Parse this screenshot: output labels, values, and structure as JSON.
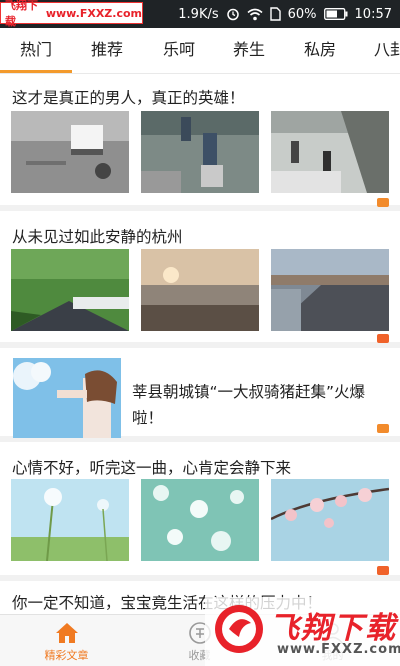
{
  "status_bar": {
    "watermark_brand": "飞翔下载",
    "watermark_url": "www.FXXZ.com",
    "speed": "1.9K/s",
    "battery": "60%",
    "time": "10:57"
  },
  "tabs": [
    {
      "label": "热门",
      "active": true
    },
    {
      "label": "推荐",
      "active": false
    },
    {
      "label": "乐呵",
      "active": false
    },
    {
      "label": "养生",
      "active": false
    },
    {
      "label": "私房",
      "active": false
    },
    {
      "label": "八卦",
      "active": false
    }
  ],
  "articles": [
    {
      "title": "这才是真正的男人，真正的英雄！",
      "layout": "three-images",
      "tag": "photo-icon"
    },
    {
      "title": "从未见过如此安静的杭州",
      "layout": "three-images",
      "tag": "video-icon"
    },
    {
      "title": "莘县朝城镇“一大叔骑猪赶集”火爆啦！",
      "layout": "side-image",
      "tag": "photo-icon"
    },
    {
      "title": "心情不好，听完这一曲，心肯定会静下来",
      "layout": "three-images",
      "tag": "video-icon"
    },
    {
      "title": "你一定不知道，宝宝竟生活在这样的压力中！",
      "layout": "three-images",
      "tag": "none"
    }
  ],
  "bottom_nav": [
    {
      "label": "精彩文章",
      "icon": "home-icon",
      "active": true
    },
    {
      "label": "收藏",
      "icon": "collect-icon",
      "active": false
    },
    {
      "label": "我的",
      "icon": "user-icon",
      "active": false
    }
  ],
  "watermark_corner": {
    "title": "飞翔下载",
    "url": "www.FXXZ.com"
  },
  "colors": {
    "accent": "#f07a22",
    "status_bar": "#1f2326",
    "tag_photo": "#f28b2c",
    "tag_video": "#f0622a"
  }
}
